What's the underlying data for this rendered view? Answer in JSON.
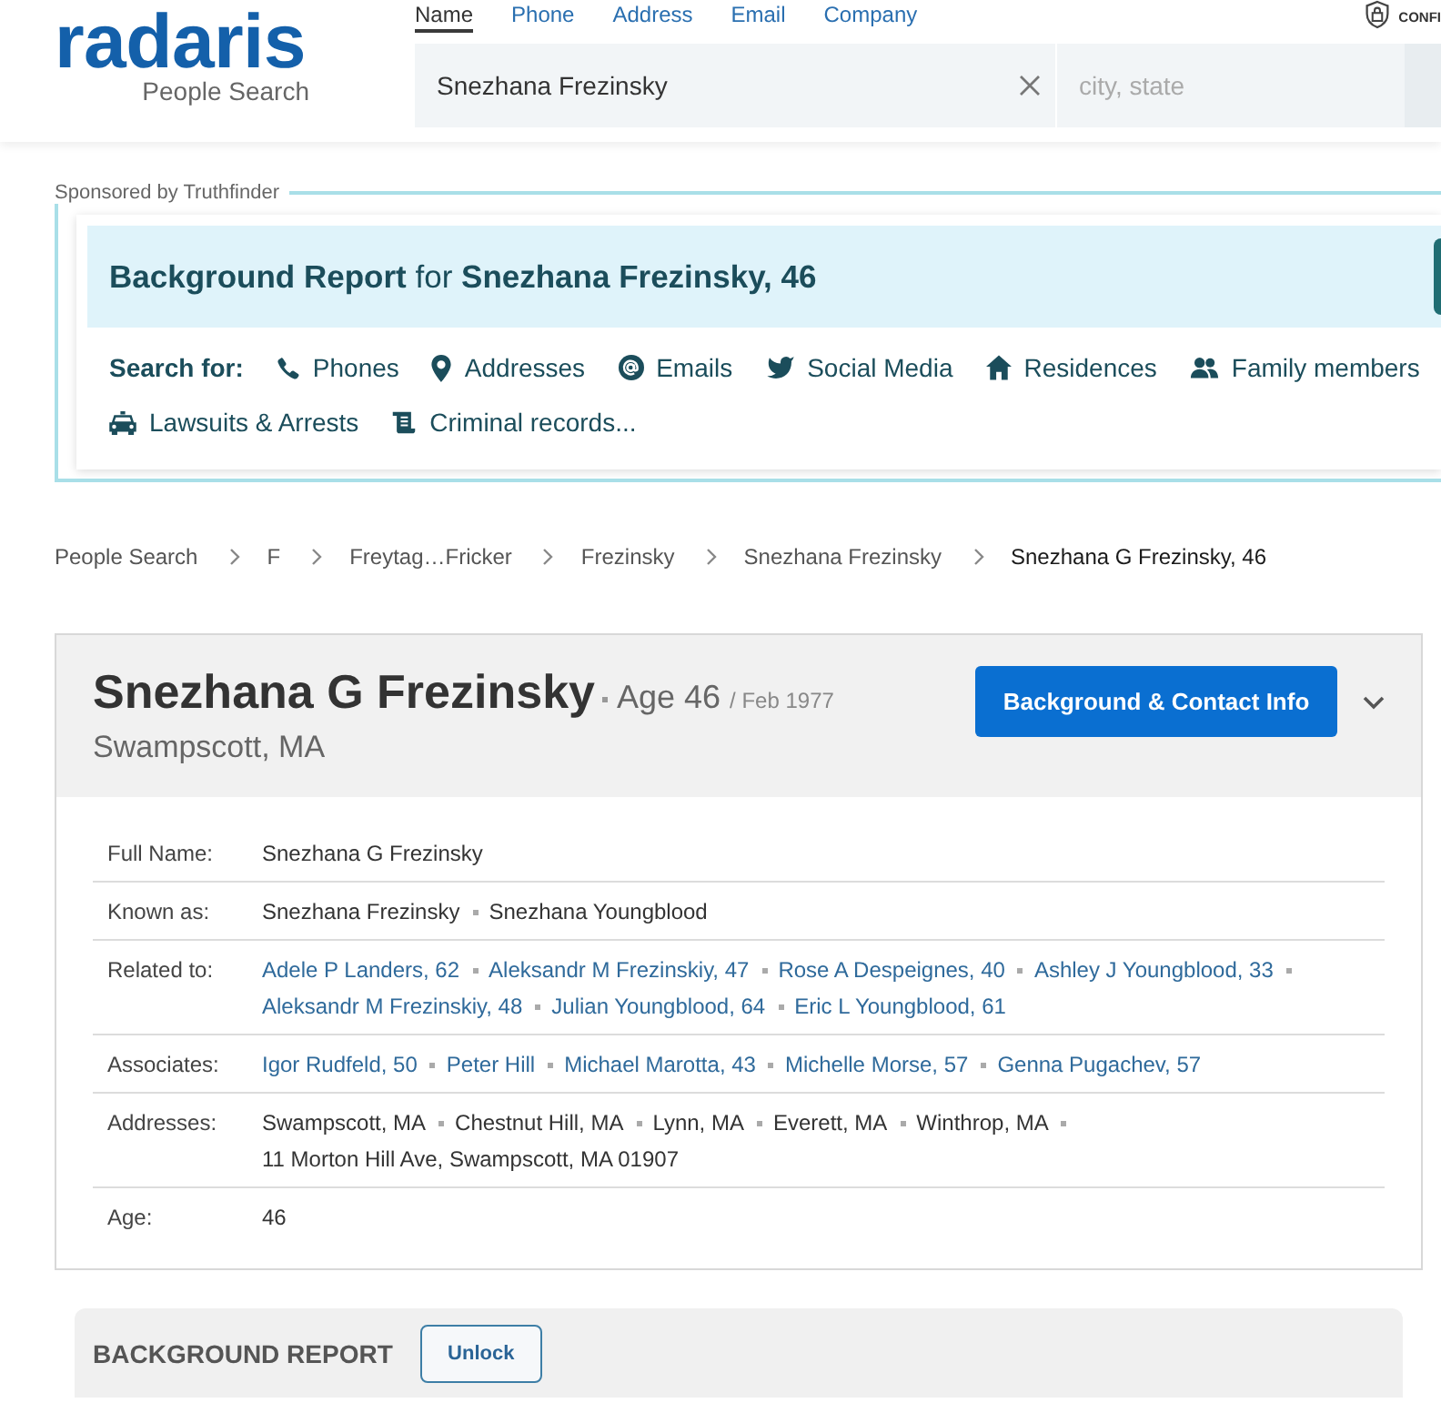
{
  "header": {
    "logo": {
      "wordmark": "radaris",
      "tagline": "People Search"
    },
    "search_tabs": [
      {
        "label": "Name",
        "selected": true
      },
      {
        "label": "Phone",
        "selected": false
      },
      {
        "label": "Address",
        "selected": false
      },
      {
        "label": "Email",
        "selected": false
      },
      {
        "label": "Company",
        "selected": false
      }
    ],
    "name_field": {
      "value": "Snezhana Frezinsky"
    },
    "location_field": {
      "placeholder": "city, state"
    },
    "security_badge": "CONFI"
  },
  "sponsored": {
    "label": "Sponsored by Truthfinder",
    "title": "**Background Report** for **Snezhana Frezinsky, 46**",
    "search_for": {
      "label": "Search for:",
      "links": [
        {
          "kind": "phone",
          "label": "Phones"
        },
        {
          "kind": "pin",
          "label": "Addresses"
        },
        {
          "kind": "email",
          "label": "Emails"
        },
        {
          "kind": "social",
          "label": "Social Media"
        },
        {
          "kind": "home",
          "label": "Residences"
        },
        {
          "kind": "family",
          "label": "Family members"
        },
        {
          "kind": "car",
          "label": "Lawsuits & Arrests"
        },
        {
          "kind": "scroll",
          "label": "Criminal records..."
        }
      ]
    }
  },
  "breadcrumbs": [
    {
      "label": "People Search",
      "current": false
    },
    {
      "label": "F",
      "current": false
    },
    {
      "label": "Freytag…Fricker",
      "current": false
    },
    {
      "label": "Frezinsky",
      "current": false
    },
    {
      "label": "Snezhana Frezinsky",
      "current": false
    },
    {
      "label": "Snezhana G Frezinsky, 46",
      "current": true
    }
  ],
  "profile": {
    "name": "Snezhana G Frezinsky",
    "age": "Age 46",
    "birth": "/ Feb 1977",
    "location": "Swampscott, MA",
    "contact_button": "Background & Contact Info"
  },
  "details": [
    {
      "label": "Full Name:",
      "kind": "text",
      "values": [
        "Snezhana G Frezinsky"
      ]
    },
    {
      "label": "Known as:",
      "kind": "text",
      "values": [
        "Snezhana Frezinsky",
        "Snezhana Youngblood"
      ]
    },
    {
      "label": "Related to:",
      "kind": "link",
      "values": [
        "Adele P Landers, 62",
        "Aleksandr M Frezinskiy, 47",
        "Rose A Despeignes, 40",
        "Ashley J Youngblood, 33",
        "Aleksandr M Frezinskiy, 48",
        "Julian Youngblood, 64",
        "Eric L Youngblood, 61"
      ]
    },
    {
      "label": "Associates:",
      "kind": "link",
      "values": [
        "Igor Rudfeld, 50",
        "Peter Hill",
        "Michael Marotta, 43",
        "Michelle Morse, 57",
        "Genna Pugachev, 57"
      ]
    },
    {
      "label": "Addresses:",
      "kind": "text",
      "values": [
        "Swampscott, MA",
        "Chestnut Hill, MA",
        "Lynn, MA",
        "Everett, MA",
        "Winthrop, MA",
        "11 Morton Hill Ave, Swampscott, MA 01907"
      ]
    },
    {
      "label": "Age:",
      "kind": "text",
      "values": [
        "46"
      ]
    }
  ],
  "background_report": {
    "title": "BACKGROUND REPORT",
    "button": "Unlock"
  }
}
